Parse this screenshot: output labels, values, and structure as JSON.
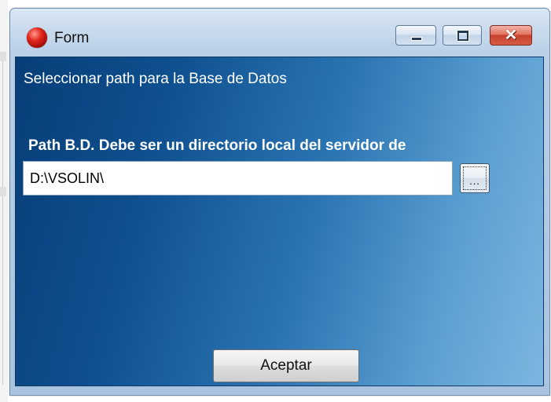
{
  "window": {
    "title": "Form",
    "icon": "red-orb-icon",
    "controls": {
      "minimize": "minimize-icon",
      "maximize": "maximize-icon",
      "close": "close-icon"
    }
  },
  "form": {
    "heading": "Seleccionar path para la Base de Datos",
    "path_label": "Path B.D. Debe ser un directorio local del servidor de",
    "path_value": "D:\\VSOLIN\\",
    "browse_label": "...",
    "accept_label": "Aceptar"
  },
  "colors": {
    "client_gradient_start": "#083e78",
    "client_gradient_end": "#7db6df",
    "close_button": "#c8422e"
  }
}
